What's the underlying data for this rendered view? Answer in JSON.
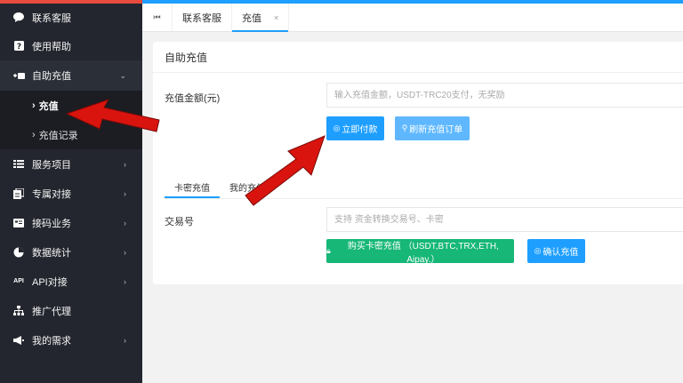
{
  "sidebar": {
    "items": [
      {
        "label": "联系客服",
        "icon": "chat-icon"
      },
      {
        "label": "使用帮助",
        "icon": "help-icon"
      },
      {
        "label": "自助充值",
        "icon": "wallet-icon",
        "open": true,
        "chevron": "⌄"
      },
      {
        "label": "服务项目",
        "icon": "list-icon",
        "chevron": "›"
      },
      {
        "label": "专属对接",
        "icon": "handshake-icon",
        "chevron": "›"
      },
      {
        "label": "接码业务",
        "icon": "sms-icon",
        "chevron": "›"
      },
      {
        "label": "数据统计",
        "icon": "stats-icon",
        "chevron": "›"
      },
      {
        "label": "API对接",
        "icon": "api-icon",
        "chevron": "›"
      },
      {
        "label": "推广代理",
        "icon": "network-icon"
      },
      {
        "label": "我的需求",
        "icon": "megaphone-icon",
        "chevron": "›"
      }
    ],
    "submenu": [
      {
        "label": "充值",
        "active": true
      },
      {
        "label": "充值记录"
      }
    ]
  },
  "tabbar": {
    "home_icon": "⏮",
    "tabs": [
      {
        "label": "联系客服"
      },
      {
        "label": "充值",
        "close": "×",
        "active": true
      }
    ]
  },
  "card": {
    "title": "自助充值",
    "amount_label": "充值金额(元)",
    "amount_placeholder": "输入充值金额，USDT-TRC20支付，无奖励",
    "pay_button": "立即付款",
    "refresh_button": "刷新充值订单",
    "subtabs": [
      "卡密充值",
      "我的充值"
    ],
    "txn_label": "交易号",
    "txn_placeholder": "支持 资金转换交易号、卡密",
    "buy_card_button": "购买卡密充值 （USDT,BTC,TRX,ETH, Aipay.）",
    "confirm_button": "确认充值"
  },
  "colors": {
    "sidebar_bg": "#23262e",
    "accent_blue": "#1e9fff",
    "green": "#16b777",
    "arrow_red": "#d9140e"
  }
}
